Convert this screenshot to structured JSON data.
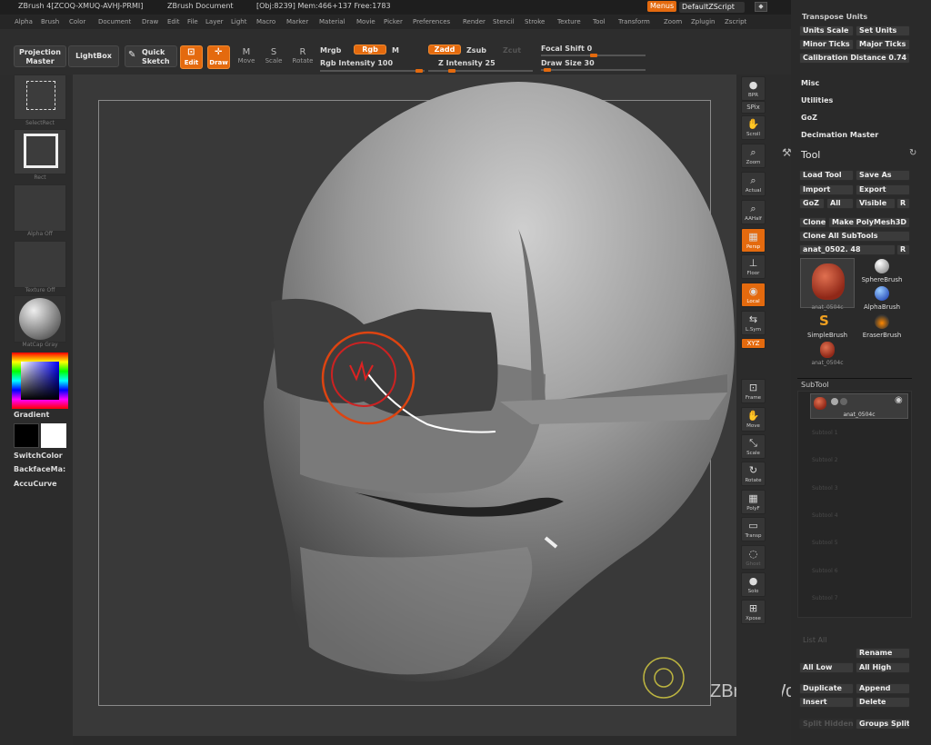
{
  "title": {
    "app": "ZBrush 4[ZCOQ-XMUQ-AVHJ-PRMI]",
    "doc": "ZBrush Document",
    "stats": "[Obj:8239] Mem:466+137 Free:1783",
    "menus_btn": "Menus",
    "script": "DefaultZScript",
    "win_buttons": [
      "◆",
      "-",
      "▢",
      "x"
    ]
  },
  "menubar": [
    "Alpha",
    "Brush",
    "Color",
    "Document",
    "Draw",
    "Edit",
    "File",
    "Layer",
    "Light",
    "Macro",
    "Marker",
    "Material",
    "Movie",
    "Picker",
    "Preferences",
    "Render",
    "Stencil",
    "Stroke",
    "Texture",
    "Tool",
    "Transform",
    "Zoom",
    "Zplugin",
    "Zscript"
  ],
  "toolbar": {
    "projection_master": [
      "Projection",
      "Master"
    ],
    "lightbox": "LightBox",
    "quick_sketch": [
      "Quick",
      "Sketch"
    ],
    "edit": "Edit",
    "draw": "Draw",
    "move": "Move",
    "scale": "Scale",
    "rotate": "Rotate",
    "mrgb": "Mrgb",
    "rgb": "Rgb",
    "m": "M",
    "rgb_intensity": "Rgb Intensity 100",
    "zadd": "Zadd",
    "zsub": "Zsub",
    "zcut": "Zcut",
    "z_intensity": "Z Intensity 25",
    "focal_shift": "Focal Shift 0",
    "draw_size": "Draw Size 30"
  },
  "left_shelf": {
    "select_rect": "SelectRect",
    "rect": "Rect",
    "alpha_off": "Alpha  Off",
    "texture_off": "Texture  Off",
    "matcap": "MatCap  Gray",
    "gradient": "Gradient",
    "switch_color": "SwitchColor",
    "backface": "BackfaceMa:",
    "accucurve": "AccuCurve"
  },
  "right_shelf": [
    {
      "label": "BPR",
      "icon": "●"
    },
    {
      "label": "SPix",
      "icon": ""
    },
    {
      "label": "Scroll",
      "icon": "✋"
    },
    {
      "label": "Zoom",
      "icon": "⌕"
    },
    {
      "label": "Actual",
      "icon": "⌕"
    },
    {
      "label": "AAHalf",
      "icon": "⌕"
    },
    {
      "label": "Persp",
      "icon": "▦"
    },
    {
      "label": "Floor",
      "icon": "⊥"
    },
    {
      "label": "Local",
      "icon": "◉"
    },
    {
      "label": "L.Sym",
      "icon": "⇆"
    },
    {
      "label": "XYZ",
      "icon": ""
    },
    {
      "label": "Frame",
      "icon": "⊡"
    },
    {
      "label": "Move",
      "icon": "✋"
    },
    {
      "label": "Scale",
      "icon": "⤡"
    },
    {
      "label": "Rotate",
      "icon": "↻"
    },
    {
      "label": "PolyF",
      "icon": "▦"
    },
    {
      "label": "Transp",
      "icon": "▭"
    },
    {
      "label": "Ghost",
      "icon": "◌"
    },
    {
      "label": "Solo",
      "icon": "●"
    },
    {
      "label": "Xpose",
      "icon": "⊞"
    }
  ],
  "panel": {
    "transpose_units": "Transpose Units",
    "units_scale": "Units Scale",
    "set_units": "Set Units",
    "minor_ticks": "Minor Ticks",
    "major_ticks": "Major Ticks",
    "calibration": "Calibration Distance 0.74",
    "misc": "Misc",
    "utilities": "Utilities",
    "goz": "GoZ",
    "decimation": "Decimation Master",
    "tool": "Tool",
    "load_tool": "Load Tool",
    "save_as": "Save As",
    "import": "Import",
    "export": "Export",
    "goz_btn": "GoZ",
    "all": "All",
    "visible": "Visible",
    "r": "R",
    "clone": "Clone",
    "make_polymesh": "Make PolyMesh3D",
    "clone_all": "Clone  All SubTools",
    "tool_name": "anat_0502. 48",
    "brushes": [
      {
        "name": "anat_0504c"
      },
      {
        "name": "SphereBrush"
      },
      {
        "name": "AlphaBrush"
      },
      {
        "name": "SimpleBrush"
      },
      {
        "name": "EraserBrush"
      },
      {
        "name": "anat_0504c"
      }
    ],
    "subtool": "SubTool",
    "subtool_item": "anat_0504c",
    "subtool_slots": [
      "Subtool 1",
      "Subtool 2",
      "Subtool 3",
      "Subtool 4",
      "Subtool 5",
      "Subtool 6",
      "Subtool 7"
    ],
    "list_all": "List  All",
    "rename": "Rename",
    "all_low": "All Low",
    "all_high": "All High",
    "duplicate": "Duplicate",
    "append": "Append",
    "insert": "Insert",
    "delete": "Delete",
    "split_hidden": "Split Hidden",
    "groups_split": "Groups Split"
  },
  "watermark": "ZBrushWorkshops"
}
